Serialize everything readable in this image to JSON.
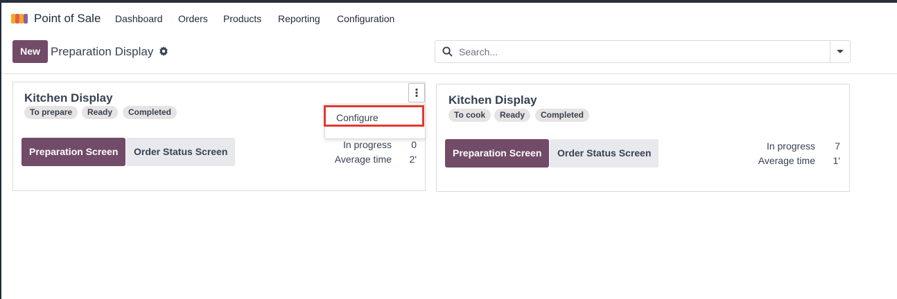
{
  "navbar": {
    "app_name": "Point of Sale",
    "app_icon": "pos-shop-icon",
    "menu": [
      "Dashboard",
      "Orders",
      "Products",
      "Reporting",
      "Configuration"
    ]
  },
  "control_panel": {
    "new_label": "New",
    "title": "Preparation Display",
    "settings_icon": "gear-icon",
    "search": {
      "placeholder": "Search...",
      "value": ""
    }
  },
  "cards": [
    {
      "title": "Kitchen Display",
      "tags": [
        "To prepare",
        "Ready",
        "Completed"
      ],
      "primary_button": "Preparation Screen",
      "secondary_button": "Order Status Screen",
      "stats": [
        {
          "label": "In progress",
          "value": "0"
        },
        {
          "label": "Average time",
          "value": "2'"
        }
      ],
      "menu_open": true
    },
    {
      "title": "Kitchen Display",
      "tags": [
        "To cook",
        "Ready",
        "Completed"
      ],
      "primary_button": "Preparation Screen",
      "secondary_button": "Order Status Screen",
      "stats": [
        {
          "label": "In progress",
          "value": "7"
        },
        {
          "label": "Average time",
          "value": "1'"
        }
      ],
      "menu_open": false
    }
  ],
  "dropdown": {
    "items": [
      "Configure"
    ],
    "highlight_color": "#e5372c"
  },
  "colors": {
    "brand": "#714b67",
    "tag_bg": "#e7e3e2",
    "secondary_btn": "#e7e9ed"
  }
}
